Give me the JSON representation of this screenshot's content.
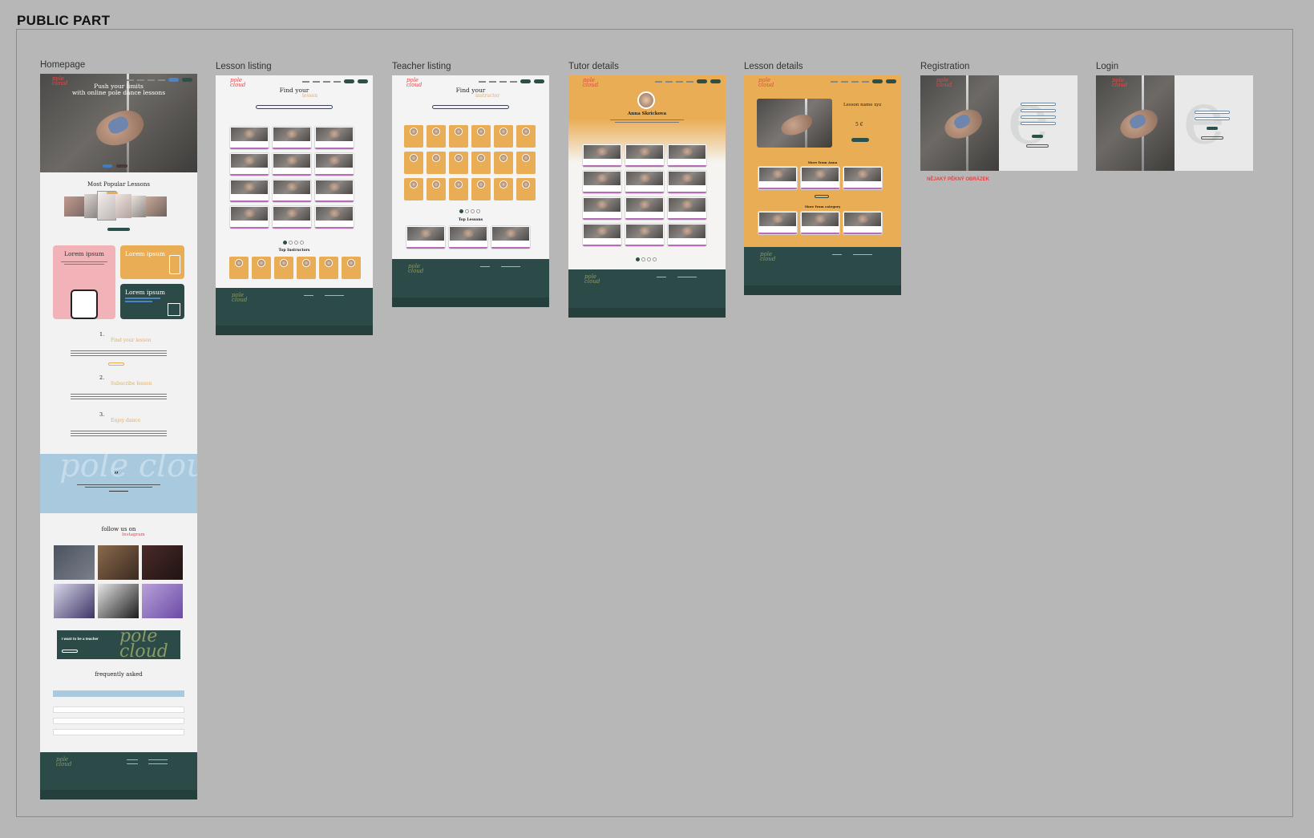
{
  "section": {
    "title": "PUBLIC PART"
  },
  "frames": {
    "homepage": "Homepage",
    "lesson_listing": "Lesson listing",
    "teacher_listing": "Teacher listing",
    "tutor_details": "Tutor details",
    "lesson_details": "Lesson details",
    "registration": "Registration",
    "login": "Login"
  },
  "homepage": {
    "hero_title_1": "Push your limits",
    "hero_title_2": "with online pole dance lessons",
    "popular_title": "Most Popular Lessons",
    "card1_title": "Lorem ipsum",
    "card2_title": "Lorem ipsum",
    "card3_title": "Lorem ipsum",
    "step1_num": "1.",
    "step1_title": "Find your lesson",
    "step2_num": "2.",
    "step2_title": "Subscribe lesson",
    "step3_num": "3.",
    "step3_title": "Enjoy dance",
    "quote_mark": "”",
    "follow_title": "follow us on",
    "follow_sub": "Instagram",
    "teacher_cta": "I want to be a teacher",
    "faq_title": "frequently asked",
    "watermark": "pole cloud"
  },
  "lesson_listing": {
    "title": "Find your",
    "sub": "lesson",
    "top_instructors": "Top Instructors"
  },
  "teacher_listing": {
    "title": "Find your",
    "sub": "instructor",
    "top_lessons": "Top Lessons"
  },
  "tutor_details": {
    "name": "Anna Skrickova"
  },
  "lesson_details": {
    "title": "Lesson name xyz",
    "price": "5 €",
    "more_1": "More from Anna",
    "more_2": "More from category"
  },
  "registration": {
    "note": "NĚJAKÝ PĚKNÝ OBRÁZEK"
  },
  "logo_text": "pole cloud",
  "colors": {
    "teal": "#2c4a47",
    "orange": "#e9ad55",
    "pink": "#f1b3b8",
    "blue": "#a8c9de",
    "background": "#b7b7b7"
  }
}
